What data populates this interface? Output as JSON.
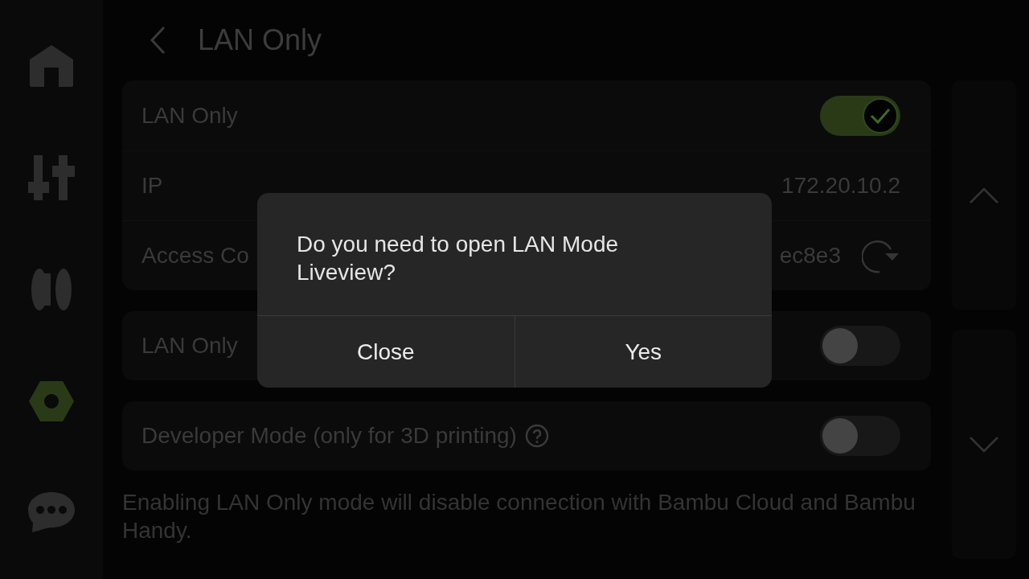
{
  "nav": [
    {
      "selected": false
    },
    {
      "selected": false
    },
    {
      "selected": false
    },
    {
      "selected": true
    },
    {
      "selected": false
    }
  ],
  "header": {
    "title": "LAN Only"
  },
  "cards": [
    {
      "rows": [
        {
          "kind": "toggle",
          "label": "LAN Only",
          "on": true
        },
        {
          "kind": "value",
          "label": "IP",
          "value": "172.20.10.2"
        },
        {
          "kind": "refresh",
          "label": "Access Co",
          "value": "ec8e3"
        }
      ]
    },
    {
      "rows": [
        {
          "kind": "toggle",
          "label": "LAN Only",
          "on": false
        }
      ]
    },
    {
      "rows": [
        {
          "kind": "help",
          "label": "Developer Mode (only for 3D printing)",
          "on": false
        }
      ]
    }
  ],
  "note": "Enabling LAN Only mode will disable connection with Bambu Cloud and Bambu Handy.",
  "dialog": {
    "message": "Do you need to open LAN Mode Liveview?",
    "buttons": [
      "Close",
      "Yes"
    ]
  }
}
